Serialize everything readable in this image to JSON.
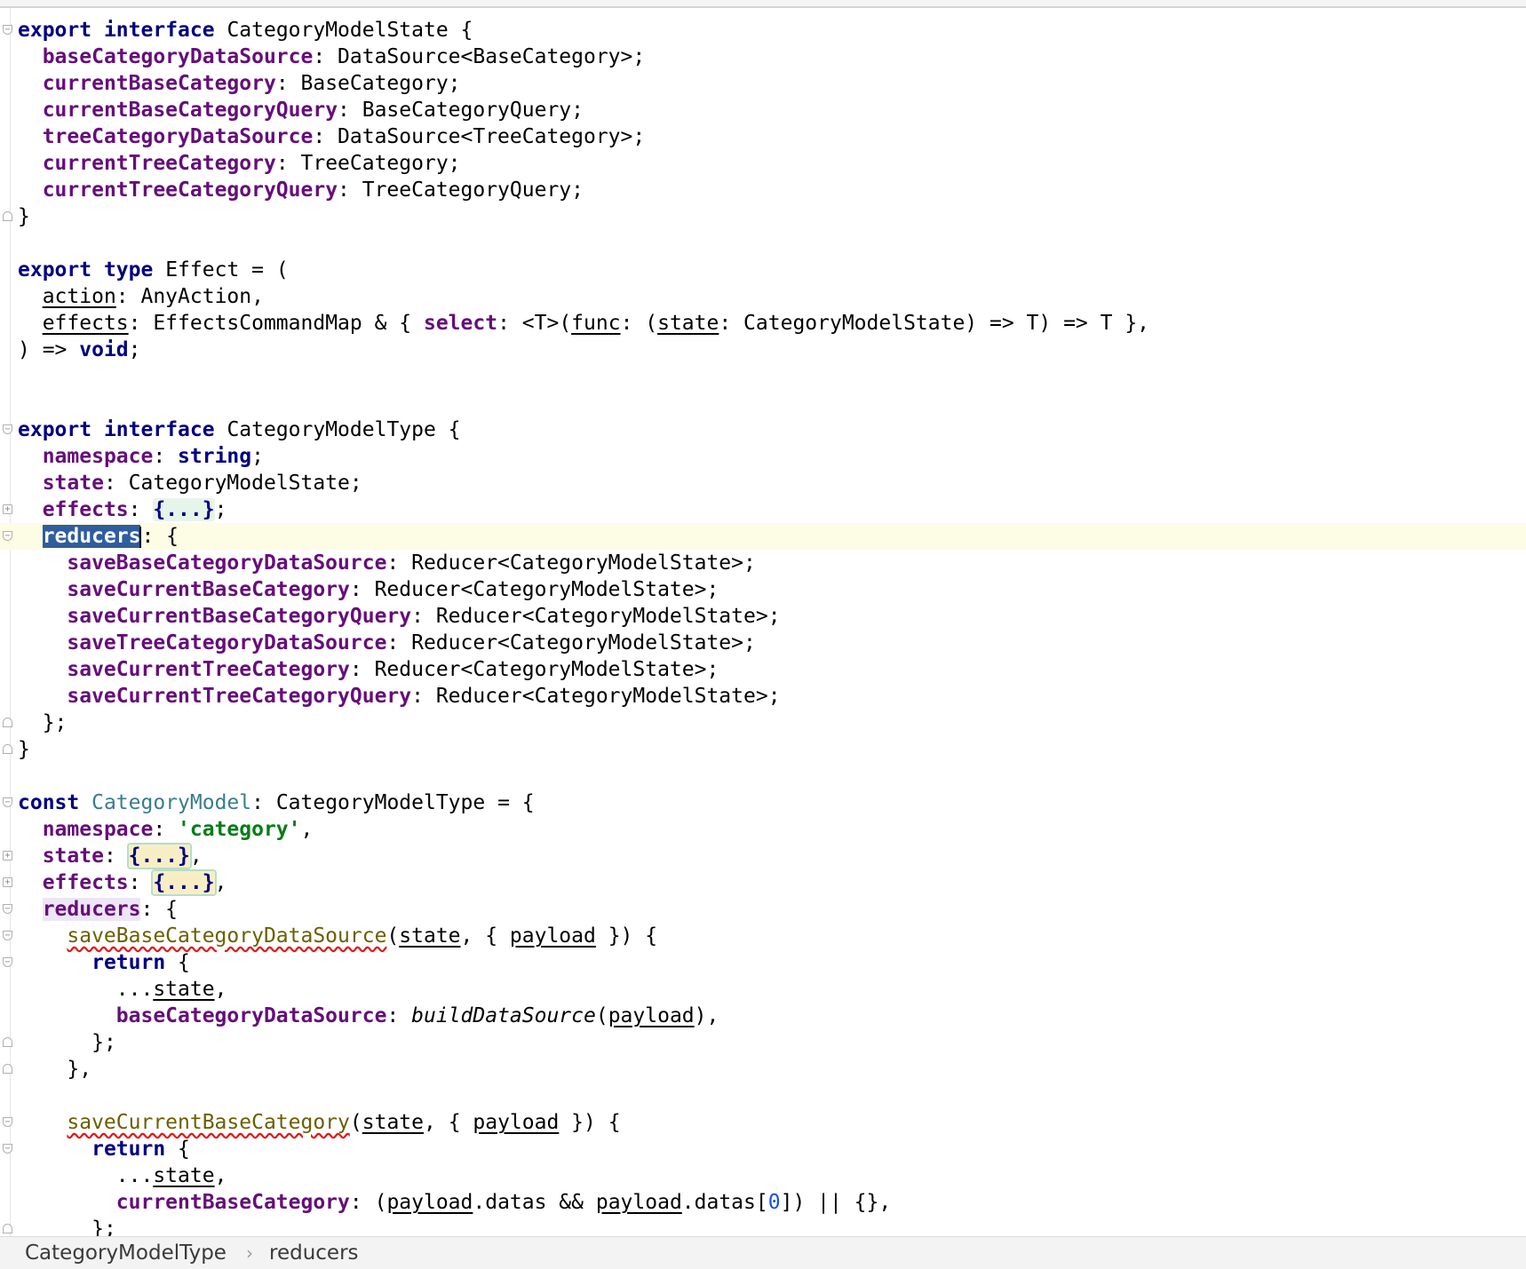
{
  "breadcrumb": {
    "items": [
      "CategoryModelType",
      "reducers"
    ],
    "separator": "›"
  },
  "code": {
    "l1": [
      "export",
      "interface",
      "CategoryModelState {"
    ],
    "l2": [
      "baseCategoryDataSource",
      ": DataSource<BaseCategory>;"
    ],
    "l3": [
      "currentBaseCategory",
      ": BaseCategory;"
    ],
    "l4": [
      "currentBaseCategoryQuery",
      ": BaseCategoryQuery;"
    ],
    "l5": [
      "treeCategoryDataSource",
      ": DataSource<TreeCategory>;"
    ],
    "l6": [
      "currentTreeCategory",
      ": TreeCategory;"
    ],
    "l7": [
      "currentTreeCategoryQuery",
      ": TreeCategoryQuery;"
    ],
    "l8": [
      "}"
    ],
    "l10": [
      "export",
      "type",
      "Effect = ("
    ],
    "l11": [
      "action",
      ": AnyAction,"
    ],
    "l12": [
      "effects",
      ": EffectsCommandMap & { ",
      "select",
      ": <T>(",
      "func",
      ": (",
      "state",
      ": CategoryModelState) => T) => T },"
    ],
    "l13": [
      ") => ",
      "void",
      ";"
    ],
    "l16": [
      "export",
      "interface",
      "CategoryModelType {"
    ],
    "l17": [
      "namespace",
      ": ",
      "string",
      ";"
    ],
    "l18": [
      "state",
      ": CategoryModelState;"
    ],
    "l19": [
      "effects",
      ": ",
      "{...}",
      ";"
    ],
    "l20": [
      "reducers",
      ": {"
    ],
    "l21": [
      "saveBaseCategoryDataSource",
      ": Reducer<CategoryModelState>;"
    ],
    "l22": [
      "saveCurrentBaseCategory",
      ": Reducer<CategoryModelState>;"
    ],
    "l23": [
      "saveCurrentBaseCategoryQuery",
      ": Reducer<CategoryModelState>;"
    ],
    "l24": [
      "saveTreeCategoryDataSource",
      ": Reducer<CategoryModelState>;"
    ],
    "l25": [
      "saveCurrentTreeCategory",
      ": Reducer<CategoryModelState>;"
    ],
    "l26": [
      "saveCurrentTreeCategoryQuery",
      ": Reducer<CategoryModelState>;"
    ],
    "l27": [
      "};"
    ],
    "l28": [
      "}"
    ],
    "l30": [
      "const",
      "CategoryModel",
      ": CategoryModelType = {"
    ],
    "l31": [
      "namespace",
      ": ",
      "'category'",
      ","
    ],
    "l32": [
      "state",
      ": ",
      "{...}",
      ","
    ],
    "l33": [
      "effects",
      ": ",
      "{...}",
      ","
    ],
    "l34": [
      "reducers",
      ": {"
    ],
    "l35": [
      "saveBaseCategoryDataSource",
      "(",
      "state",
      ", { ",
      "payload",
      " }) {"
    ],
    "l36": [
      "return",
      " {"
    ],
    "l37": [
      "...",
      "state",
      ","
    ],
    "l38": [
      "baseCategoryDataSource",
      ": ",
      "buildDataSource",
      "(",
      "payload",
      "),"
    ],
    "l39": [
      "};"
    ],
    "l40": [
      "},"
    ],
    "l42": [
      "saveCurrentBaseCategory",
      "(",
      "state",
      ", { ",
      "payload",
      " }) {"
    ],
    "l43": [
      "return",
      " {"
    ],
    "l44": [
      "...",
      "state",
      ","
    ],
    "l45": [
      "currentBaseCategory",
      ": (",
      "payload",
      ".datas && ",
      "payload",
      ".datas[",
      "0",
      "]) || {},"
    ],
    "l46": [
      "};"
    ]
  }
}
